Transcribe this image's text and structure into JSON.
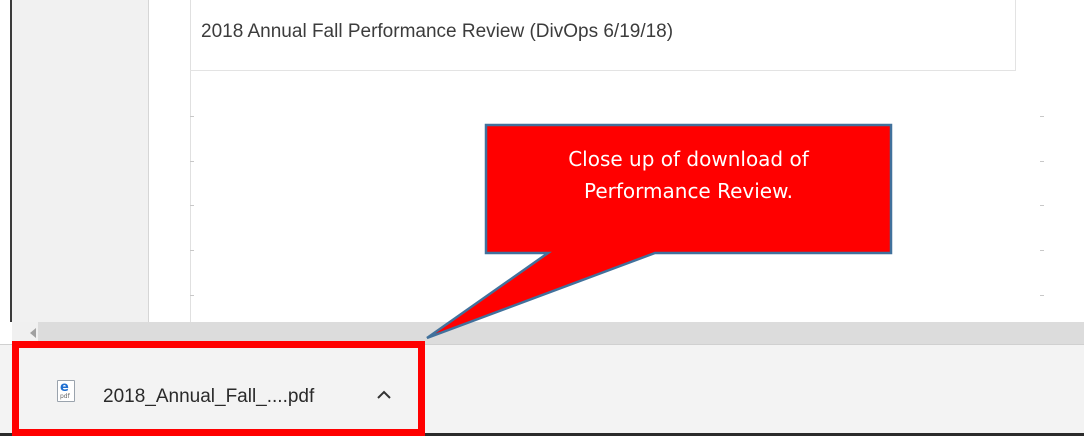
{
  "table": {
    "row_title": "2018 Annual Fall Performance Review (DivOps 6/19/18)"
  },
  "callout": {
    "line1": "Close up of download of",
    "line2": "Performance Review.",
    "fill_color": "#ff0000",
    "border_color": "#41719c"
  },
  "download_bar": {
    "file_name": "2018_Annual_Fall_....pdf",
    "file_icon": "pdf-file-icon",
    "menu_icon": "chevron-up-icon",
    "highlight_color": "#ff0000"
  }
}
